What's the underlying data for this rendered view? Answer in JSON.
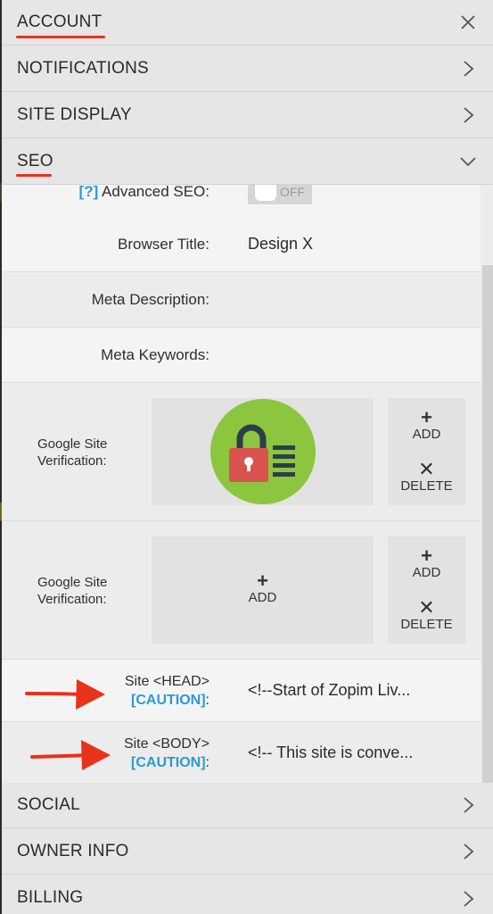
{
  "sections": {
    "account": "ACCOUNT",
    "notifications": "NOTIFICATIONS",
    "site_display": "SITE DISPLAY",
    "seo": "SEO",
    "social": "SOCIAL",
    "owner_info": "OWNER INFO",
    "billing": "BILLING"
  },
  "seo": {
    "advanced_help": "[?]",
    "advanced_label": " Advanced SEO:",
    "advanced_toggle": "OFF",
    "browser_title_label": "Browser Title:",
    "browser_title_value": "Design X",
    "meta_description_label": "Meta Description:",
    "meta_description_value": "",
    "meta_keywords_label": "Meta Keywords:",
    "meta_keywords_value": "",
    "google_verif_label_1": "Google Site Verification:",
    "google_verif_label_2": "Google Site Verification:",
    "add_label": "ADD",
    "delete_label": "DELETE",
    "site_head_label": "Site <HEAD>",
    "site_head_caution": "[CAUTION]",
    "site_head_colon": ":",
    "site_head_value": "<!--Start of Zopim Liv...",
    "site_body_label": "Site <BODY>",
    "site_body_caution": "[CAUTION]",
    "site_body_colon": ":",
    "site_body_value": "<!-- This site is conve..."
  },
  "icons": {
    "close": "close-icon",
    "chevron_right": "chevron-right-icon",
    "chevron_down": "chevron-down-icon",
    "lock_list": "lock-list-icon",
    "annotation_arrow": "red-arrow-icon"
  },
  "colors": {
    "accent_red": "#e8321a",
    "link_blue": "#2a9ad6",
    "lock_badge_green": "#8cc63f"
  }
}
